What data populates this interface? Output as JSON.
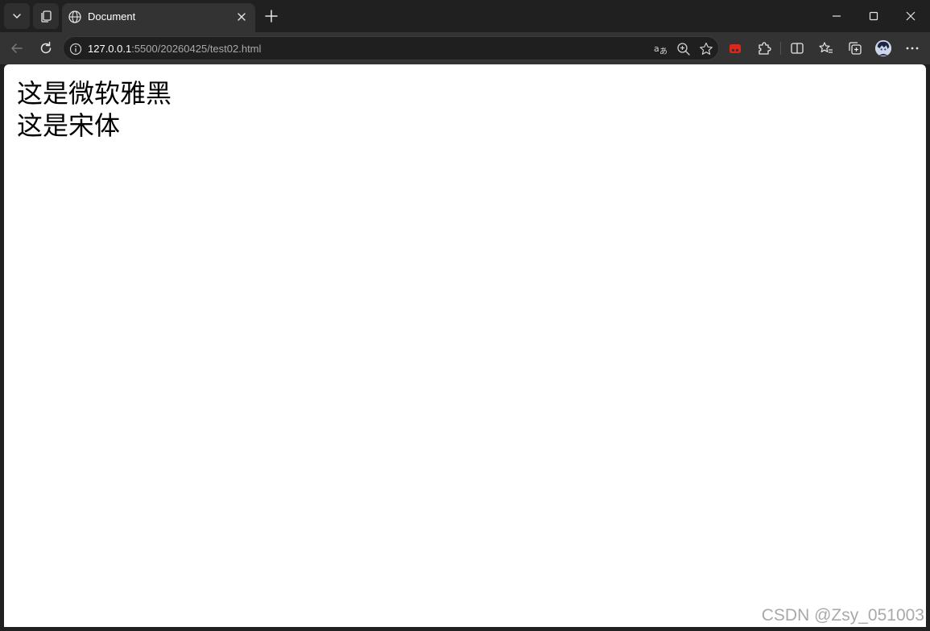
{
  "browser": {
    "tab": {
      "title": "Document"
    },
    "address_bar": {
      "host": "127.0.0.1",
      "path": ":5500/20260425/test02.html"
    }
  },
  "page": {
    "line1": "这是微软雅黑",
    "line2": "这是宋体"
  },
  "watermark": "CSDN @Zsy_051003",
  "colors": {
    "titlebar_bg": "#202020",
    "toolbar_bg": "#333333",
    "omnibox_bg": "#1f1f1f",
    "page_bg": "#ffffff",
    "extension_red": "#e0251b"
  },
  "icons": [
    "tab-list-icon",
    "workspaces-icon",
    "globe-icon",
    "close-icon",
    "plus-icon",
    "minimize-icon",
    "maximize-icon",
    "window-close-icon",
    "back-icon",
    "refresh-icon",
    "info-icon",
    "read-aloud-icon",
    "zoom-icon",
    "favorite-star-icon",
    "extension-red-icon",
    "extensions-puzzle-icon",
    "split-screen-icon",
    "favorites-icon",
    "collections-icon",
    "profile-avatar",
    "more-icon"
  ]
}
